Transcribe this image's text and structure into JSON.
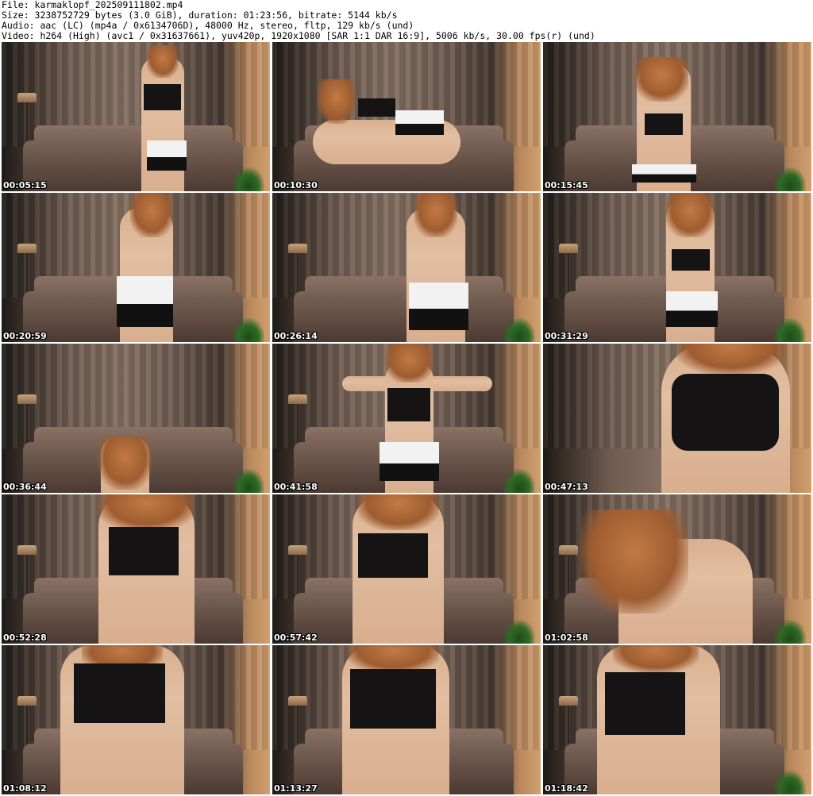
{
  "header": {
    "file_line": "File: karmaklopf_202509111802.mp4",
    "size_line": "Size: 3238752729 bytes (3.0 GiB), duration: 01:23:56, bitrate: 5144 kb/s",
    "audio_line": "Audio: aac (LC) (mp4a / 0x6134706D), 48000 Hz, stereo, fltp, 129 kb/s (und)",
    "video_line": "Video: h264 (High) (avc1 / 0x31637661), yuv420p, 1920x1080 [SAR 1:1 DAR 16:9], 5006 kb/s, 30.00 fps(r) (und)"
  },
  "thumbnails": [
    {
      "timestamp": "00:05:15"
    },
    {
      "timestamp": "00:10:30"
    },
    {
      "timestamp": "00:15:45"
    },
    {
      "timestamp": "00:20:59"
    },
    {
      "timestamp": "00:26:14"
    },
    {
      "timestamp": "00:31:29"
    },
    {
      "timestamp": "00:36:44"
    },
    {
      "timestamp": "00:41:58"
    },
    {
      "timestamp": "00:47:13"
    },
    {
      "timestamp": "00:52:28"
    },
    {
      "timestamp": "00:57:42"
    },
    {
      "timestamp": "01:02:58"
    },
    {
      "timestamp": "01:08:12"
    },
    {
      "timestamp": "01:13:27"
    },
    {
      "timestamp": "01:18:42"
    }
  ]
}
